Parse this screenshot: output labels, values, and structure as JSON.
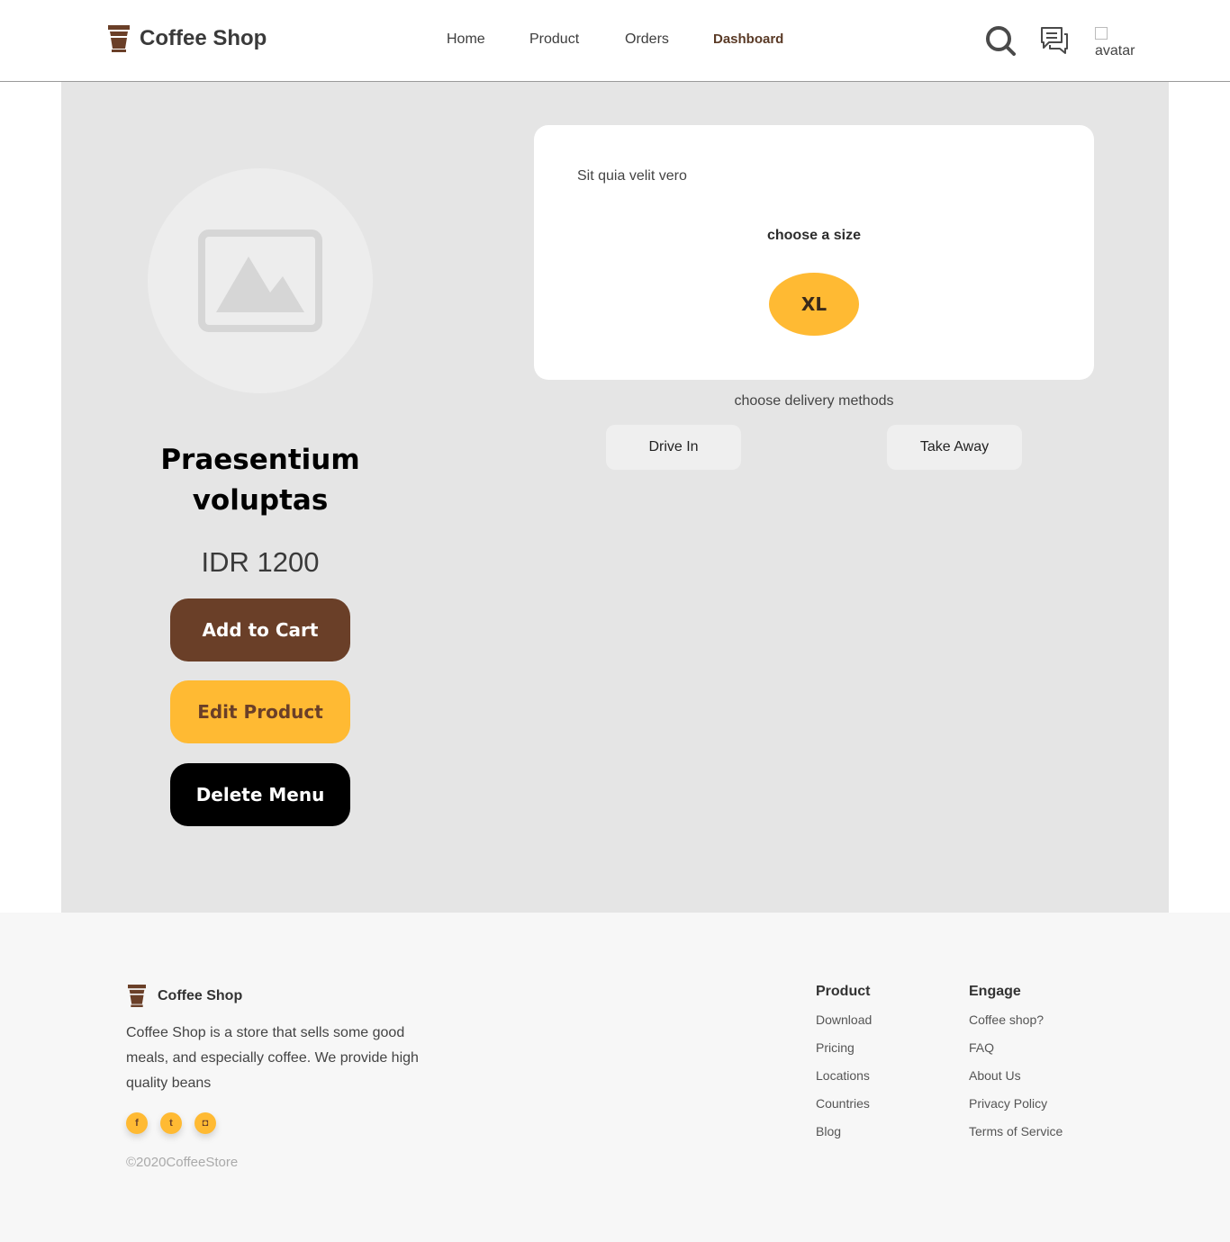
{
  "header": {
    "brand": "Coffee Shop",
    "nav": [
      {
        "label": "Home",
        "active": false
      },
      {
        "label": "Product",
        "active": false
      },
      {
        "label": "Orders",
        "active": false
      },
      {
        "label": "Dashboard",
        "active": true
      }
    ],
    "icons": [
      "search-icon",
      "chat-icon"
    ],
    "avatar_alt": "avatar"
  },
  "product": {
    "image_icon": "image-placeholder-icon",
    "name": "Praesentium voluptas",
    "price": "IDR 1200",
    "buttons": {
      "add_to_cart": "Add to Cart",
      "edit": "Edit Product",
      "delete": "Delete Menu"
    },
    "description": "Sit quia velit vero",
    "size_label": "choose a size",
    "size_selected": "XL",
    "delivery_label": "choose delivery methods",
    "delivery_options": [
      "Drive In",
      "Take Away"
    ]
  },
  "footer": {
    "brand": "Coffee Shop",
    "description": "Coffee Shop is a store that sells some good meals, and especially coffee. We provide high quality beans",
    "socials": [
      {
        "name": "facebook-icon",
        "glyph": "f"
      },
      {
        "name": "twitter-icon",
        "glyph": "t"
      },
      {
        "name": "instagram-icon",
        "glyph": "◘"
      }
    ],
    "copyright": "©2020CoffeeStore",
    "columns": {
      "product": {
        "title": "Product",
        "links": [
          "Download",
          "Pricing",
          "Locations",
          "Countries",
          "Blog"
        ]
      },
      "engage": {
        "title": "Engage",
        "links": [
          "Coffee shop?",
          "FAQ",
          "About Us",
          "Privacy Policy",
          "Terms of Service"
        ]
      }
    }
  },
  "colors": {
    "brand_brown": "#6a3f28",
    "accent_yellow": "#ffba33",
    "main_bg": "#e5e5e5",
    "footer_bg": "#f7f7f7"
  }
}
